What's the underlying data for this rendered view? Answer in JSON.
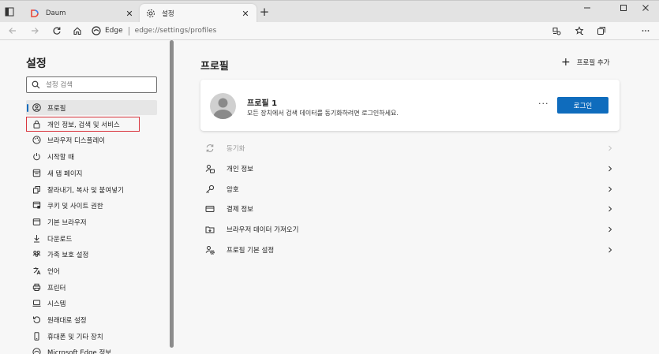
{
  "browser": {
    "tabs": [
      {
        "title": "Daum",
        "icon": "daum-icon",
        "active": false
      },
      {
        "title": "설정",
        "icon": "gear-icon",
        "active": true
      }
    ],
    "address": {
      "site_label": "Edge",
      "url": "edge://settings/profiles"
    },
    "accent_color": "#0f6cbd"
  },
  "sidebar": {
    "title": "설정",
    "search_placeholder": "설정 검색",
    "items": [
      {
        "label": "프로필",
        "icon": "profile-icon"
      },
      {
        "label": "개인 정보, 검색 및 서비스",
        "icon": "lock-icon"
      },
      {
        "label": "브라우저 디스플레이",
        "icon": "appearance-icon"
      },
      {
        "label": "시작할 때",
        "icon": "power-icon"
      },
      {
        "label": "새 탭 페이지",
        "icon": "new-tab-page-icon"
      },
      {
        "label": "잘라내기, 복사 및 붙여넣기",
        "icon": "clipboard-icon"
      },
      {
        "label": "쿠키 및 사이트 권한",
        "icon": "site-permissions-icon"
      },
      {
        "label": "기본 브라우저",
        "icon": "browser-icon"
      },
      {
        "label": "다운로드",
        "icon": "download-icon"
      },
      {
        "label": "가족 보호 설정",
        "icon": "family-icon"
      },
      {
        "label": "언어",
        "icon": "language-icon"
      },
      {
        "label": "프린터",
        "icon": "printer-icon"
      },
      {
        "label": "시스템",
        "icon": "system-icon"
      },
      {
        "label": "원래대로 설정",
        "icon": "reset-icon"
      },
      {
        "label": "휴대폰 및 기타 장치",
        "icon": "phone-icon"
      },
      {
        "label": "Microsoft Edge 정보",
        "icon": "edge-icon"
      }
    ]
  },
  "main": {
    "title": "프로필",
    "add_profile": "프로필 추가",
    "profile_card": {
      "name": "프로필 1",
      "description": "모든 장치에서 검색 데이터를 동기화하려면 로그인하세요.",
      "login_label": "로그인",
      "more_label": "···"
    },
    "rows": [
      {
        "label": "동기화",
        "icon": "sync-icon",
        "disabled": true
      },
      {
        "label": "개인 정보",
        "icon": "personal-info-icon",
        "disabled": false
      },
      {
        "label": "암호",
        "icon": "key-icon",
        "disabled": false
      },
      {
        "label": "결제 정보",
        "icon": "credit-card-icon",
        "disabled": false
      },
      {
        "label": "브라우저 데이터 가져오기",
        "icon": "import-icon",
        "disabled": false
      },
      {
        "label": "프로필 기본 설정",
        "icon": "profile-settings-icon",
        "disabled": false
      }
    ]
  }
}
